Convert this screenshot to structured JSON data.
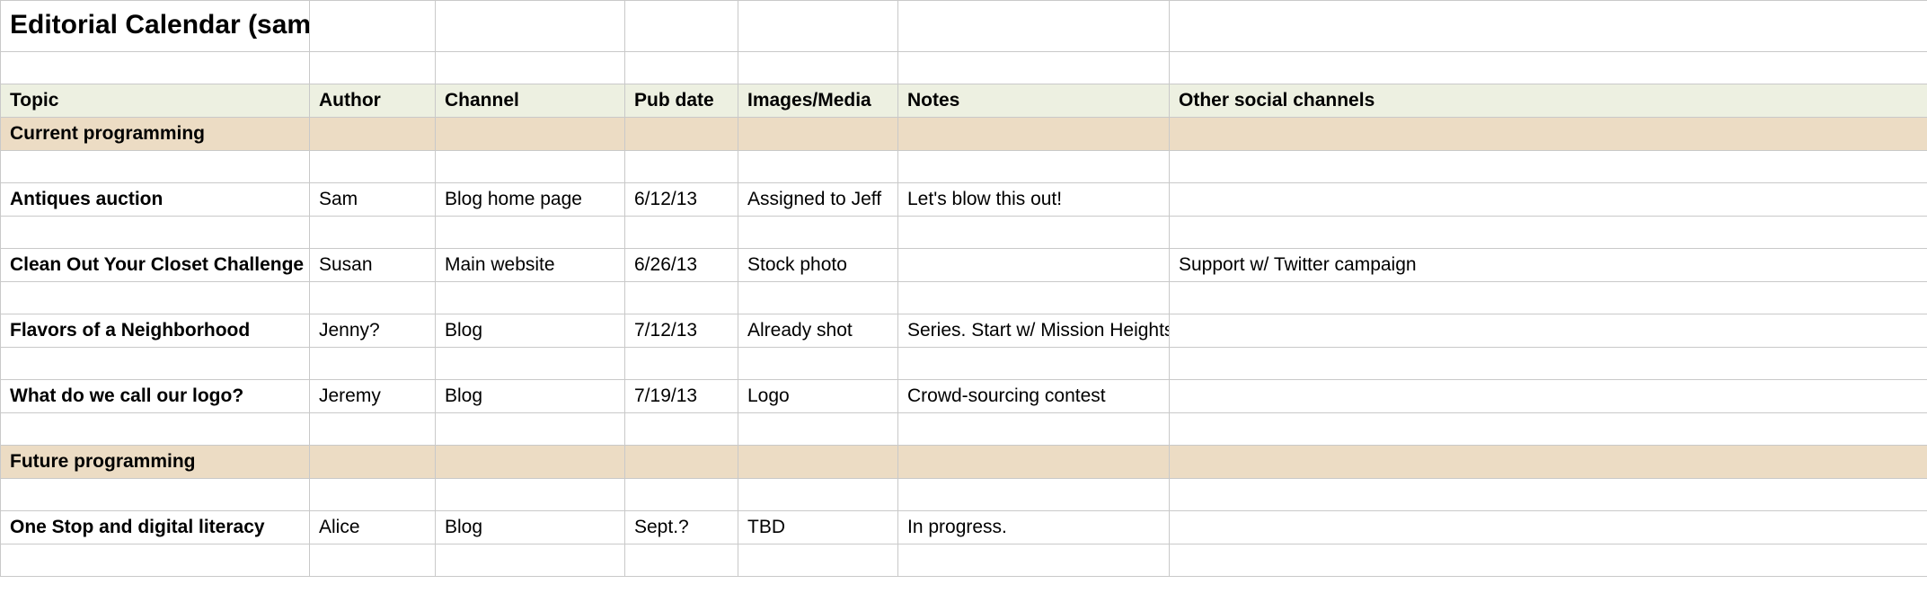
{
  "title": "Editorial Calendar (sample)",
  "headers": {
    "topic": "Topic",
    "author": "Author",
    "channel": "Channel",
    "pubdate": "Pub date",
    "images": "Images/Media",
    "notes": "Notes",
    "other": "Other social channels"
  },
  "sections": {
    "current": "Current programming",
    "future": "Future programming"
  },
  "rows": {
    "current": [
      {
        "topic": "Antiques auction",
        "author": "Sam",
        "channel": "Blog home page",
        "pubdate": "6/12/13",
        "images": "Assigned to Jeff",
        "notes": "Let's blow this out!",
        "other": ""
      },
      {
        "topic": "Clean Out Your Closet Challenge",
        "author": "Susan",
        "channel": "Main website",
        "pubdate": "6/26/13",
        "images": "Stock photo",
        "notes": "",
        "other": "Support w/ Twitter campaign"
      },
      {
        "topic": "Flavors of a Neighborhood",
        "author": "Jenny?",
        "channel": "Blog",
        "pubdate": "7/12/13",
        "images": "Already shot",
        "notes": "Series. Start w/ Mission Heights",
        "other": ""
      },
      {
        "topic": "What do we call our logo?",
        "author": "Jeremy",
        "channel": "Blog",
        "pubdate": "7/19/13",
        "images": "Logo",
        "notes": "Crowd-sourcing contest",
        "other": ""
      }
    ],
    "future": [
      {
        "topic": "One Stop and digital literacy",
        "author": "Alice",
        "channel": "Blog",
        "pubdate": "Sept.?",
        "images": "TBD",
        "notes": "In progress.",
        "other": ""
      }
    ]
  }
}
